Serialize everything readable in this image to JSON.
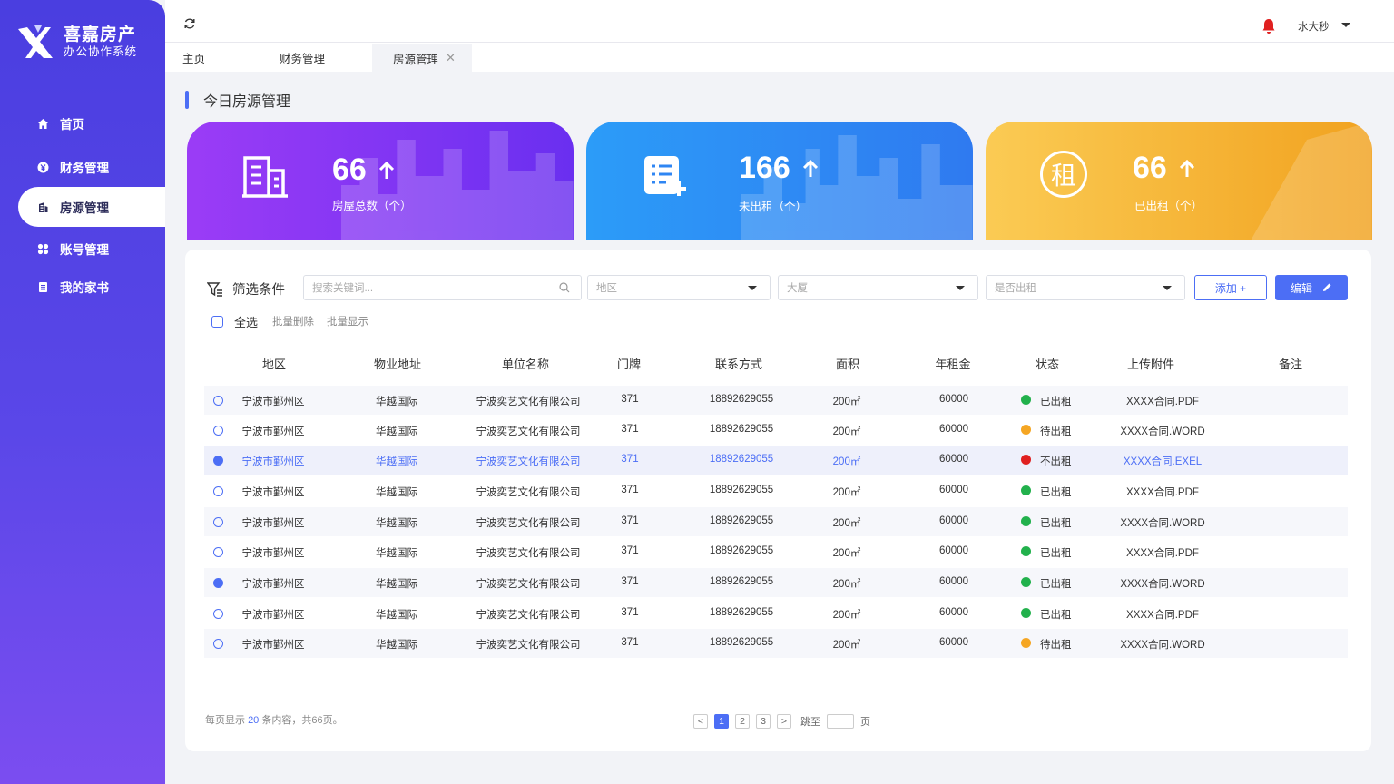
{
  "brand": {
    "title": "喜嘉房产",
    "subtitle": "办公协作系统"
  },
  "sidebar": {
    "items": [
      {
        "label": "首页",
        "icon": "home-icon",
        "active": false
      },
      {
        "label": "财务管理",
        "icon": "yen-icon",
        "active": false
      },
      {
        "label": "房源管理",
        "icon": "building-icon",
        "active": true
      },
      {
        "label": "账号管理",
        "icon": "grid-icon",
        "active": false
      },
      {
        "label": "我的家书",
        "icon": "book-icon",
        "active": false
      }
    ]
  },
  "header": {
    "username": "水大秒"
  },
  "tabs": [
    {
      "label": "主页"
    },
    {
      "label": "财务管理"
    },
    {
      "label": "房源管理",
      "closable": true
    }
  ],
  "page_title": "今日房源管理",
  "stats": [
    {
      "value": "66",
      "label": "房屋总数（个）",
      "gradient": [
        "#9b3cf6",
        "#6a2ff0"
      ]
    },
    {
      "value": "166",
      "label": "未出租（个）",
      "gradient": [
        "#2c9cf8",
        "#2f7af0"
      ]
    },
    {
      "value": "66",
      "label": "已出租（个）",
      "gradient": [
        "#fbcb54",
        "#f1a21f"
      ],
      "icon_char": "租"
    }
  ],
  "filter": {
    "label": "筛选条件",
    "search_placeholder": "搜索关键词...",
    "region_placeholder": "地区",
    "building_placeholder": "大厦",
    "rented_placeholder": "是否出租",
    "add_label": "添加 +",
    "edit_label": "编辑"
  },
  "batch": {
    "select_all": "全选",
    "delete": "批量删除",
    "show": "批量显示"
  },
  "table": {
    "columns": [
      "地区",
      "物业地址",
      "单位名称",
      "门牌",
      "联系方式",
      "面积",
      "年租金",
      "状态",
      "上传附件",
      "备注"
    ],
    "rows": [
      {
        "region": "宁波市鄞州区",
        "address": "华越国际",
        "company": "宁波奕艺文化有限公司",
        "door": "371",
        "phone": "18892629055",
        "area": "200㎡",
        "rent": "60000",
        "status": "已出租",
        "status_color": "#22b14c",
        "file": "XXXX合同.PDF",
        "note": "",
        "checked": false,
        "highlight": false
      },
      {
        "region": "宁波市鄞州区",
        "address": "华越国际",
        "company": "宁波奕艺文化有限公司",
        "door": "371",
        "phone": "18892629055",
        "area": "200㎡",
        "rent": "60000",
        "status": "待出租",
        "status_color": "#f5a623",
        "file": "XXXX合同.WORD",
        "note": "",
        "checked": false,
        "highlight": false
      },
      {
        "region": "宁波市鄞州区",
        "address": "华越国际",
        "company": "宁波奕艺文化有限公司",
        "door": "371",
        "phone": "18892629055",
        "area": "200㎡",
        "rent": "60000",
        "status": "不出租",
        "status_color": "#e02020",
        "file": "XXXX合同.EXEL",
        "note": "",
        "checked": true,
        "highlight": true
      },
      {
        "region": "宁波市鄞州区",
        "address": "华越国际",
        "company": "宁波奕艺文化有限公司",
        "door": "371",
        "phone": "18892629055",
        "area": "200㎡",
        "rent": "60000",
        "status": "已出租",
        "status_color": "#22b14c",
        "file": "XXXX合同.PDF",
        "note": "",
        "checked": false,
        "highlight": false
      },
      {
        "region": "宁波市鄞州区",
        "address": "华越国际",
        "company": "宁波奕艺文化有限公司",
        "door": "371",
        "phone": "18892629055",
        "area": "200㎡",
        "rent": "60000",
        "status": "已出租",
        "status_color": "#22b14c",
        "file": "XXXX合同.WORD",
        "note": "",
        "checked": false,
        "highlight": false
      },
      {
        "region": "宁波市鄞州区",
        "address": "华越国际",
        "company": "宁波奕艺文化有限公司",
        "door": "371",
        "phone": "18892629055",
        "area": "200㎡",
        "rent": "60000",
        "status": "已出租",
        "status_color": "#22b14c",
        "file": "XXXX合同.PDF",
        "note": "",
        "checked": false,
        "highlight": false
      },
      {
        "region": "宁波市鄞州区",
        "address": "华越国际",
        "company": "宁波奕艺文化有限公司",
        "door": "371",
        "phone": "18892629055",
        "area": "200㎡",
        "rent": "60000",
        "status": "已出租",
        "status_color": "#22b14c",
        "file": "XXXX合同.WORD",
        "note": "",
        "checked": true,
        "highlight": false
      },
      {
        "region": "宁波市鄞州区",
        "address": "华越国际",
        "company": "宁波奕艺文化有限公司",
        "door": "371",
        "phone": "18892629055",
        "area": "200㎡",
        "rent": "60000",
        "status": "已出租",
        "status_color": "#22b14c",
        "file": "XXXX合同.PDF",
        "note": "",
        "checked": false,
        "highlight": false
      },
      {
        "region": "宁波市鄞州区",
        "address": "华越国际",
        "company": "宁波奕艺文化有限公司",
        "door": "371",
        "phone": "18892629055",
        "area": "200㎡",
        "rent": "60000",
        "status": "待出租",
        "status_color": "#f5a623",
        "file": "XXXX合同.WORD",
        "note": "",
        "checked": false,
        "highlight": false
      }
    ]
  },
  "footer": {
    "info_prefix": "每页显示 ",
    "per_page": "20",
    "info_suffix": " 条内容，共66页。",
    "pages": [
      "1",
      "2",
      "3"
    ],
    "current_page": "1",
    "jump_label": "跳至",
    "page_unit": "页",
    "prev": "<",
    "next": ">"
  },
  "colors": {
    "accent": "#4c6ef5",
    "sidebar": "#4a3ee0"
  }
}
